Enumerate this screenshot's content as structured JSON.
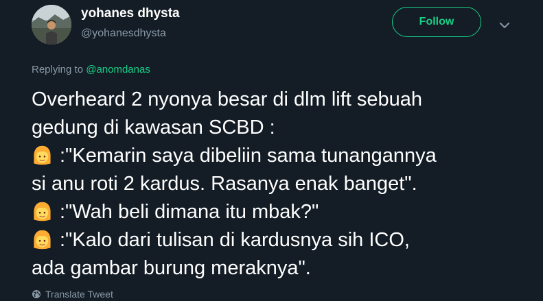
{
  "author": {
    "display_name": "yohanes dhysta",
    "handle": "@yohanesdhysta",
    "avatar_icon": "profile-photo"
  },
  "header": {
    "follow_label": "Follow",
    "menu_icon": "chevron-down-icon"
  },
  "reply": {
    "prefix": "Replying to ",
    "mention": "@anomdanas"
  },
  "tweet": {
    "lines": [
      "Overheard 2 nyonya besar di dlm lift sebuah",
      "gedung di kawasan SCBD :",
      ":\"Kemarin saya dibeliin sama tunangannya",
      "si anu roti 2 kardus. Rasanya enak banget\".",
      ":\"Wah beli dimana itu mbak?\"",
      ":\"Kalo dari tulisan di kardusnya sih ICO,",
      "ada gambar burung meraknya\"."
    ],
    "emoji": "woman-emoji"
  },
  "footer": {
    "translate_label": "Translate Tweet",
    "translate_icon": "globe-icon"
  },
  "colors": {
    "background": "#141d26",
    "accent": "#19cf86",
    "secondary_text": "#8899a6",
    "primary_text": "#ffffff"
  }
}
